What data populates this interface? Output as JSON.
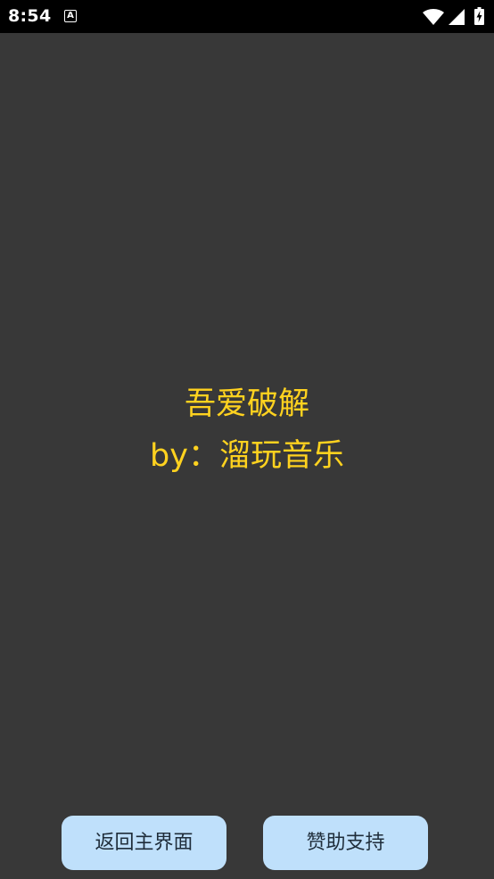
{
  "status_bar": {
    "time": "8:54",
    "notification_icon": "accessibility-a-icon",
    "notification_glyph": "A",
    "wifi_icon": "wifi-icon",
    "signal_icon": "cell-signal-icon",
    "battery_icon": "battery-charging-icon"
  },
  "message": {
    "line1": "吾爱破解",
    "line2": "by：溜玩音乐",
    "color": "#ffd21f"
  },
  "buttons": {
    "back_label": "返回主界面",
    "support_label": "赞助支持",
    "background": "#bfe0fb"
  },
  "colors": {
    "background": "#383838",
    "status_bar": "#000000"
  }
}
